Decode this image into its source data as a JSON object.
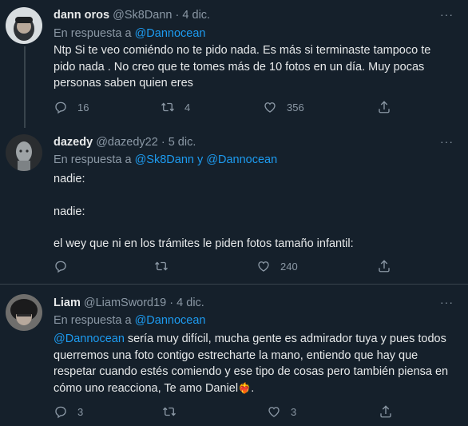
{
  "tweets": [
    {
      "name": "dann oros",
      "handle": "@Sk8Dann",
      "sep": "·",
      "date": "4 dic.",
      "reply_prefix": "En respuesta a ",
      "reply_to": "@Dannocean",
      "text": "Ntp Si te veo comiéndo no te pido nada. Es más si terminaste tampoco te pido nada . No creo que te tomes más de 10 fotos en un día. Muy pocas personas saben quien eres",
      "replies": "16",
      "retweets": "4",
      "likes": "356"
    },
    {
      "name": "dazedy",
      "handle": "@dazedy22",
      "sep": "·",
      "date": "5 dic.",
      "reply_prefix": "En respuesta a ",
      "reply_to": "@Sk8Dann y @Dannocean",
      "text_lines": [
        "nadie:",
        "nadie:",
        "el wey que ni en los trámites le piden fotos tamaño infantil:"
      ],
      "replies": "",
      "retweets": "",
      "likes": "240"
    },
    {
      "name": "Liam",
      "handle": "@LiamSword19",
      "sep": "·",
      "date": "4 dic.",
      "reply_prefix": "En respuesta a ",
      "reply_to": "@Dannocean",
      "mention": "@Dannocean",
      "text": " sería muy difícil, mucha gente es admirador tuya y pues todos querremos una foto contigo estrecharte la mano, entiendo que hay que respetar cuando estés comiendo y ese tipo de cosas pero también piensa en cómo uno reacciona, Te amo Daniel",
      "emoji": "❤️‍🔥",
      "text_end": ".",
      "replies": "3",
      "retweets": "",
      "likes": "3"
    }
  ],
  "more_label": "···",
  "colors": {
    "background": "#15202b",
    "link": "#1d9bf0",
    "muted": "#8b98a5",
    "divider": "#38444d"
  },
  "icons": [
    "reply-icon",
    "retweet-icon",
    "like-icon",
    "share-icon",
    "more-icon"
  ]
}
